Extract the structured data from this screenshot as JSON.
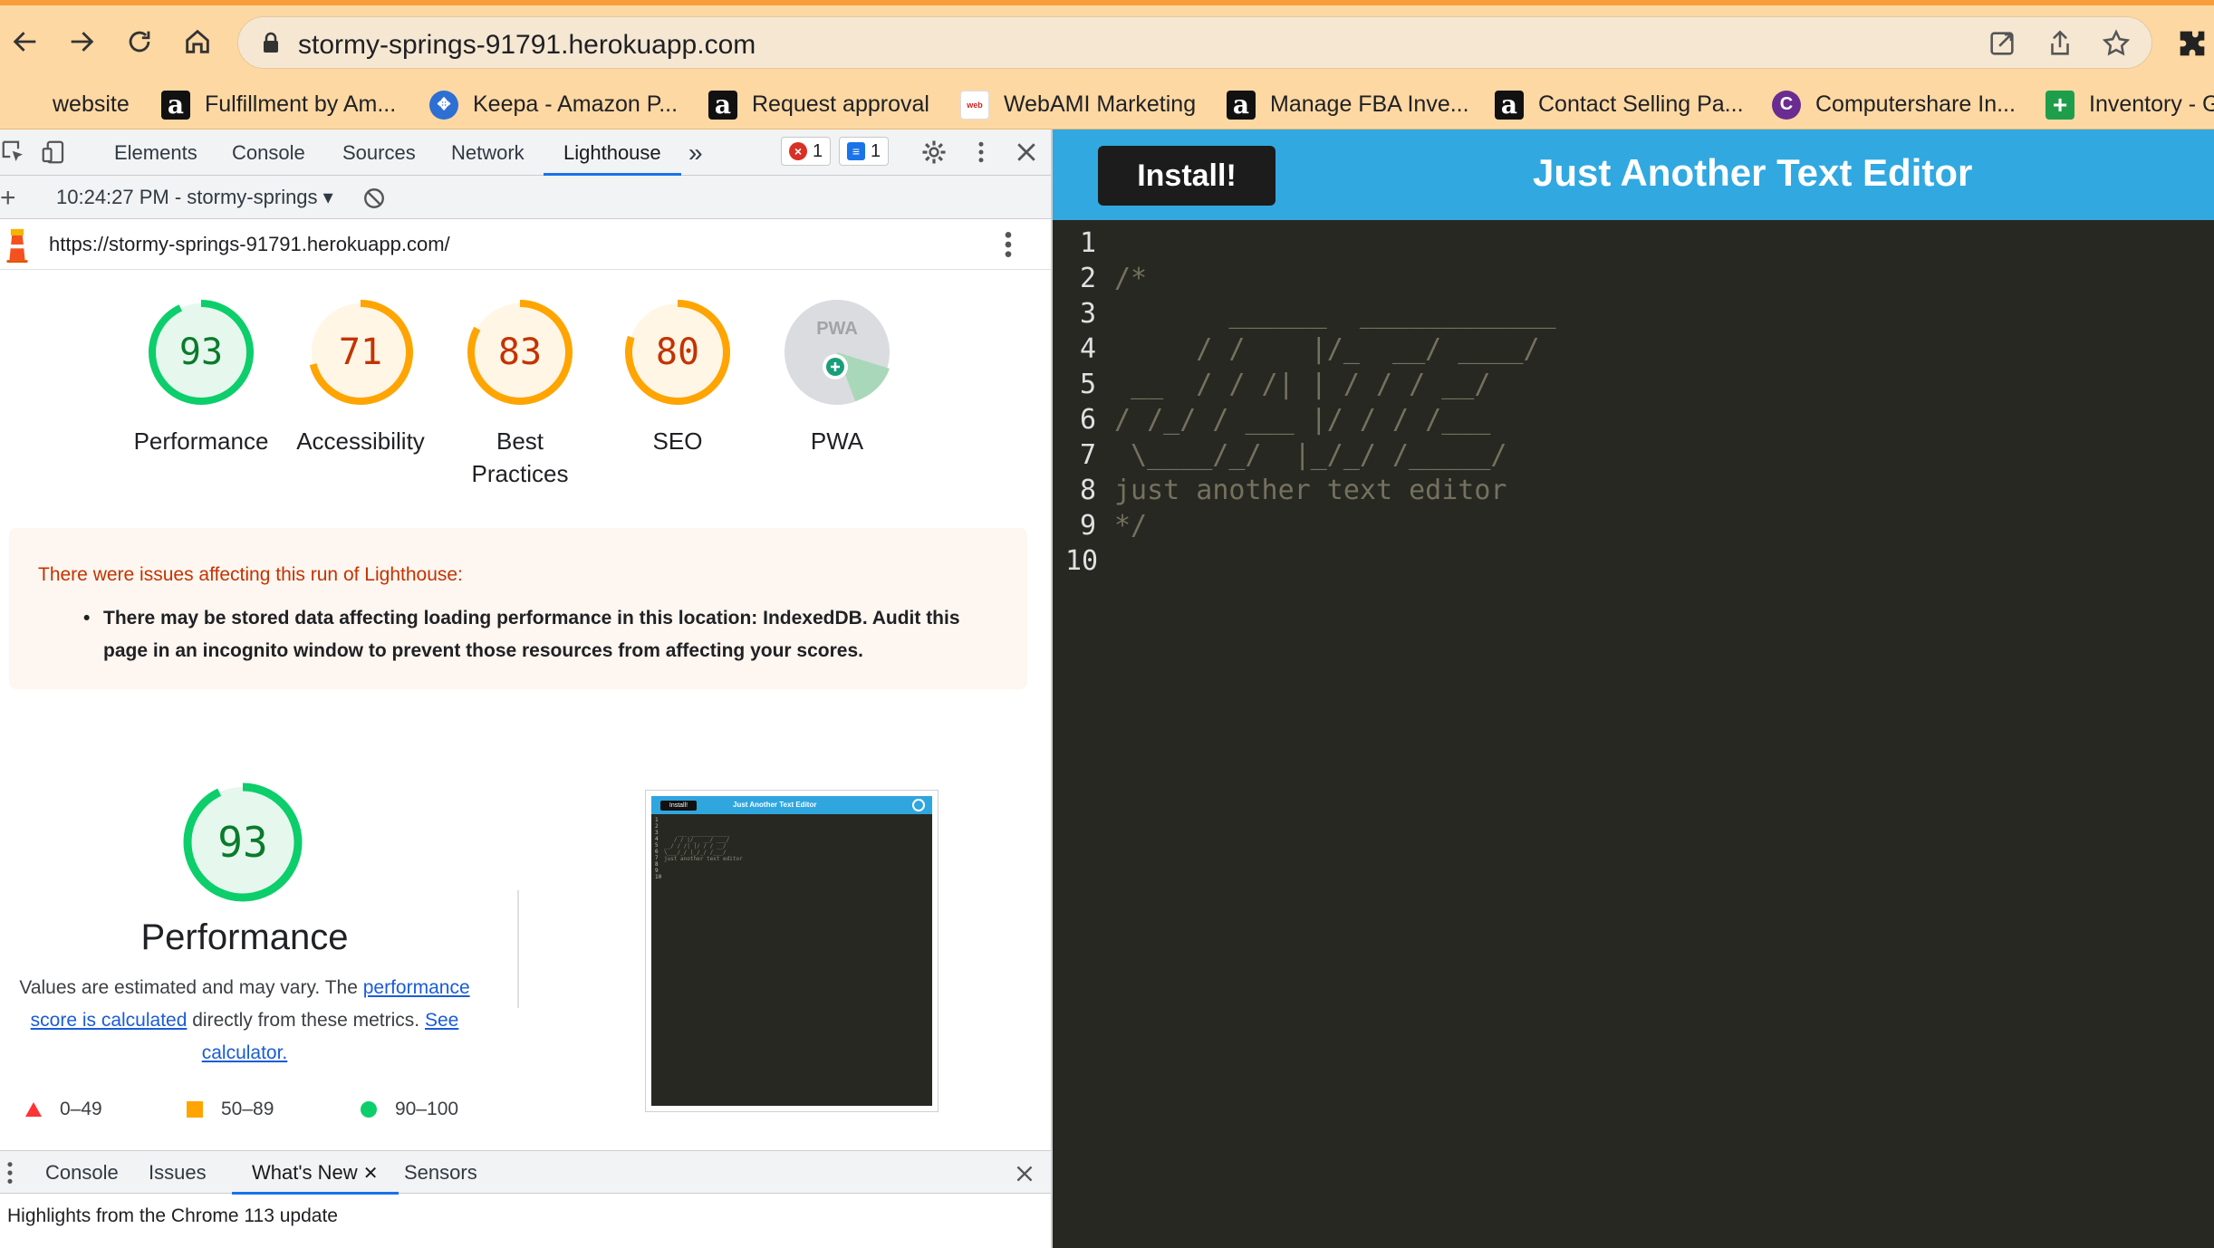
{
  "browser": {
    "url": "stormy-springs-91791.herokuapp.com",
    "bookmarks": [
      {
        "label": "website",
        "icon": "none"
      },
      {
        "label": "Fulfillment by Am...",
        "icon": "amazon-icon"
      },
      {
        "label": "Keepa - Amazon P...",
        "icon": "keepa-icon"
      },
      {
        "label": "Request approval",
        "icon": "amazon-icon"
      },
      {
        "label": "WebAMI Marketing",
        "icon": "webami-icon"
      },
      {
        "label": "Manage FBA Inve...",
        "icon": "amazon-icon"
      },
      {
        "label": "Contact Selling Pa...",
        "icon": "amazon-icon"
      },
      {
        "label": "Computershare In...",
        "icon": "computershare-icon"
      },
      {
        "label": "Inventory - G",
        "icon": "sheets-icon"
      }
    ]
  },
  "devtools": {
    "tabs": [
      "Elements",
      "Console",
      "Sources",
      "Network",
      "Lighthouse"
    ],
    "active_tab": "Lighthouse",
    "error_count": "1",
    "message_count": "1",
    "report_time": "10:24:27 PM - stormy-springs",
    "report_url": "https://stormy-springs-91791.herokuapp.com/",
    "scores": [
      {
        "value": "93",
        "label": "Performance",
        "color": "#0cce6b"
      },
      {
        "value": "71",
        "label": "Accessibility",
        "color": "#ffa400"
      },
      {
        "value": "83",
        "label": "Best Practices",
        "color": "#ffa400"
      },
      {
        "value": "80",
        "label": "SEO",
        "color": "#ffa400"
      }
    ],
    "pwa_label": "PWA",
    "pwa_badge_text": "PWA",
    "issues_heading": "There were issues affecting this run of Lighthouse:",
    "issues_item": "There may be stored data affecting loading performance in this location: IndexedDB. Audit this page in an incognito window to prevent those resources from affecting your scores.",
    "perf_score": "93",
    "perf_score_fraction": 0.93,
    "perf_title": "Performance",
    "perf_desc_1": "Values are estimated and may vary. The ",
    "perf_desc_link_1": "performance score is calculated",
    "perf_desc_2": " directly from these metrics. ",
    "perf_desc_link_2": "See calculator.",
    "legend": [
      "0–49",
      "50–89",
      "90–100"
    ],
    "thumb": {
      "install": "Install!",
      "title": "Just Another Text Editor",
      "code_line": "just another text editor"
    },
    "drawer_tabs": [
      "Console",
      "Issues",
      "What's New",
      "Sensors"
    ],
    "drawer_active": "What's New",
    "drawer_content": "Highlights from the Chrome 113 update"
  },
  "app": {
    "install_label": "Install!",
    "title": "Just Another Text Editor",
    "lines": [
      {
        "n": "1",
        "text": ""
      },
      {
        "n": "2",
        "text": "/*"
      },
      {
        "n": "3",
        "text": "       ______  ____________"
      },
      {
        "n": "4",
        "text": "     / /    |/_  __/ ____/"
      },
      {
        "n": "5",
        "text": " __  / / /| | / / / __/"
      },
      {
        "n": "6",
        "text": "/ /_/ / ___ |/ / / /___"
      },
      {
        "n": "7",
        "text": " \\____/_/  |_/_/ /_____/"
      },
      {
        "n": "8",
        "text": "just another text editor"
      },
      {
        "n": "9",
        "text": "*/"
      },
      {
        "n": "10",
        "text": ""
      }
    ]
  }
}
